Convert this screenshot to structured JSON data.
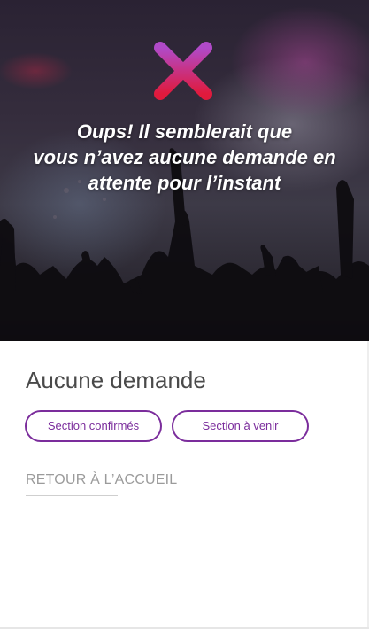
{
  "hero": {
    "icon": "close-icon",
    "message_lines": [
      "Oups! Il semblerait que",
      "vous n’avez aucune demande en",
      "attente pour l’instant"
    ]
  },
  "main": {
    "title": "Aucune demande",
    "buttons": {
      "confirmed": "Section confirmés",
      "upcoming": "Section à venir"
    },
    "back_link": "RETOUR À L’ACCUEIL"
  },
  "colors": {
    "accent": "#7b2d9c",
    "icon_gradient_top": "#b04ac9",
    "icon_gradient_bottom": "#e01a3c"
  }
}
